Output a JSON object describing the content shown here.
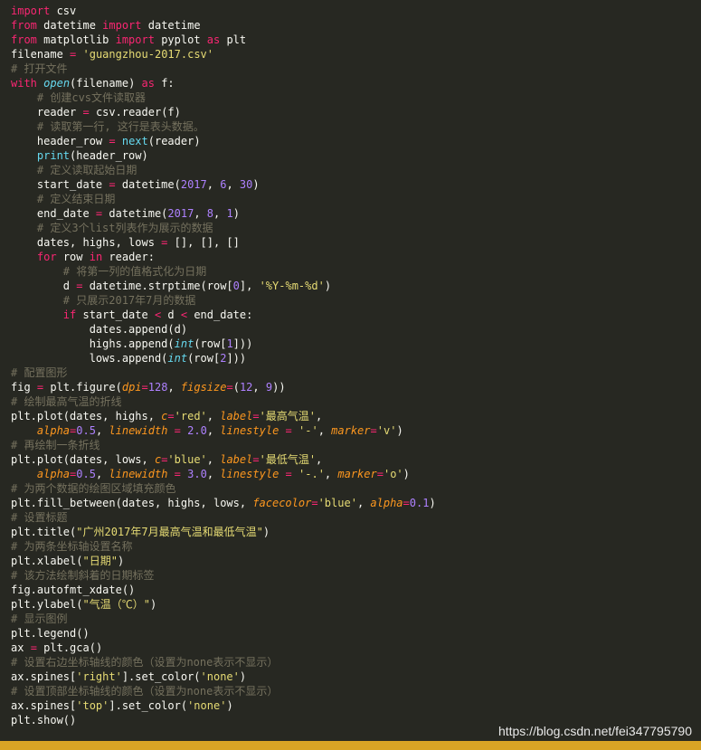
{
  "code_lines": [
    [
      {
        "t": "import",
        "c": "kw"
      },
      {
        "t": " csv"
      }
    ],
    [
      {
        "t": "from",
        "c": "kw"
      },
      {
        "t": " datetime "
      },
      {
        "t": "import",
        "c": "kw"
      },
      {
        "t": " datetime"
      }
    ],
    [
      {
        "t": "from",
        "c": "kw"
      },
      {
        "t": " matplotlib "
      },
      {
        "t": "import",
        "c": "kw"
      },
      {
        "t": " pyplot "
      },
      {
        "t": "as",
        "c": "kw"
      },
      {
        "t": " plt"
      }
    ],
    [
      {
        "t": "filename "
      },
      {
        "t": "=",
        "c": "op"
      },
      {
        "t": " "
      },
      {
        "t": "'guangzhou-2017.csv'",
        "c": "str"
      }
    ],
    [
      {
        "t": "# 打开文件",
        "c": "cm"
      }
    ],
    [
      {
        "t": "with",
        "c": "kw"
      },
      {
        "t": " "
      },
      {
        "t": "open",
        "c": "it"
      },
      {
        "t": "(filename) "
      },
      {
        "t": "as",
        "c": "kw"
      },
      {
        "t": " f:"
      }
    ],
    [
      {
        "t": "    # 创建cvs文件读取器",
        "c": "cm"
      }
    ],
    [
      {
        "t": "    reader "
      },
      {
        "t": "=",
        "c": "op"
      },
      {
        "t": " csv.reader(f)"
      }
    ],
    [
      {
        "t": "    # 读取第一行, 这行是表头数据。",
        "c": "cm"
      }
    ],
    [
      {
        "t": "    header_row "
      },
      {
        "t": "=",
        "c": "op"
      },
      {
        "t": " "
      },
      {
        "t": "next",
        "c": "bi"
      },
      {
        "t": "(reader)"
      }
    ],
    [
      {
        "t": "    "
      },
      {
        "t": "print",
        "c": "bi"
      },
      {
        "t": "(header_row)"
      }
    ],
    [
      {
        "t": "    # 定义读取起始日期",
        "c": "cm"
      }
    ],
    [
      {
        "t": "    start_date "
      },
      {
        "t": "=",
        "c": "op"
      },
      {
        "t": " datetime("
      },
      {
        "t": "2017",
        "c": "num"
      },
      {
        "t": ", "
      },
      {
        "t": "6",
        "c": "num"
      },
      {
        "t": ", "
      },
      {
        "t": "30",
        "c": "num"
      },
      {
        "t": ")"
      }
    ],
    [
      {
        "t": "    # 定义结束日期",
        "c": "cm"
      }
    ],
    [
      {
        "t": "    end_date "
      },
      {
        "t": "=",
        "c": "op"
      },
      {
        "t": " datetime("
      },
      {
        "t": "2017",
        "c": "num"
      },
      {
        "t": ", "
      },
      {
        "t": "8",
        "c": "num"
      },
      {
        "t": ", "
      },
      {
        "t": "1",
        "c": "num"
      },
      {
        "t": ")"
      }
    ],
    [
      {
        "t": "    # 定义3个list列表作为展示的数据",
        "c": "cm"
      }
    ],
    [
      {
        "t": "    dates, highs, lows "
      },
      {
        "t": "=",
        "c": "op"
      },
      {
        "t": " [], [], []"
      }
    ],
    [
      {
        "t": "    "
      },
      {
        "t": "for",
        "c": "kw"
      },
      {
        "t": " row "
      },
      {
        "t": "in",
        "c": "kw"
      },
      {
        "t": " reader:"
      }
    ],
    [
      {
        "t": "        # 将第一列的值格式化为日期",
        "c": "cm"
      }
    ],
    [
      {
        "t": "        d "
      },
      {
        "t": "=",
        "c": "op"
      },
      {
        "t": " datetime.strptime(row["
      },
      {
        "t": "0",
        "c": "num"
      },
      {
        "t": "], "
      },
      {
        "t": "'%Y-%m-%d'",
        "c": "str"
      },
      {
        "t": ")"
      }
    ],
    [
      {
        "t": "        # 只展示2017年7月的数据",
        "c": "cm"
      }
    ],
    [
      {
        "t": "        "
      },
      {
        "t": "if",
        "c": "kw"
      },
      {
        "t": " start_date "
      },
      {
        "t": "<",
        "c": "op"
      },
      {
        "t": " d "
      },
      {
        "t": "<",
        "c": "op"
      },
      {
        "t": " end_date:"
      }
    ],
    [
      {
        "t": "            dates.append(d)"
      }
    ],
    [
      {
        "t": "            highs.append("
      },
      {
        "t": "int",
        "c": "it"
      },
      {
        "t": "(row["
      },
      {
        "t": "1",
        "c": "num"
      },
      {
        "t": "]))"
      }
    ],
    [
      {
        "t": "            lows.append("
      },
      {
        "t": "int",
        "c": "it"
      },
      {
        "t": "(row["
      },
      {
        "t": "2",
        "c": "num"
      },
      {
        "t": "]))"
      }
    ],
    [
      {
        "t": "# 配置图形",
        "c": "cm"
      }
    ],
    [
      {
        "t": "fig "
      },
      {
        "t": "=",
        "c": "op"
      },
      {
        "t": " plt.figure("
      },
      {
        "t": "dpi",
        "c": "kwarg"
      },
      {
        "t": "=",
        "c": "op"
      },
      {
        "t": "128",
        "c": "num"
      },
      {
        "t": ", "
      },
      {
        "t": "figsize",
        "c": "kwarg"
      },
      {
        "t": "=",
        "c": "op"
      },
      {
        "t": "("
      },
      {
        "t": "12",
        "c": "num"
      },
      {
        "t": ", "
      },
      {
        "t": "9",
        "c": "num"
      },
      {
        "t": "))"
      }
    ],
    [
      {
        "t": "# 绘制最高气温的折线",
        "c": "cm"
      }
    ],
    [
      {
        "t": "plt.plot(dates, highs, "
      },
      {
        "t": "c",
        "c": "kwarg"
      },
      {
        "t": "=",
        "c": "op"
      },
      {
        "t": "'red'",
        "c": "str"
      },
      {
        "t": ", "
      },
      {
        "t": "label",
        "c": "kwarg"
      },
      {
        "t": "=",
        "c": "op"
      },
      {
        "t": "'最高气温'",
        "c": "str"
      },
      {
        "t": ","
      }
    ],
    [
      {
        "t": "    "
      },
      {
        "t": "alpha",
        "c": "kwarg"
      },
      {
        "t": "=",
        "c": "op"
      },
      {
        "t": "0.5",
        "c": "num"
      },
      {
        "t": ", "
      },
      {
        "t": "linewidth",
        "c": "kwarg"
      },
      {
        "t": " "
      },
      {
        "t": "=",
        "c": "op"
      },
      {
        "t": " "
      },
      {
        "t": "2.0",
        "c": "num"
      },
      {
        "t": ", "
      },
      {
        "t": "linestyle",
        "c": "kwarg"
      },
      {
        "t": " "
      },
      {
        "t": "=",
        "c": "op"
      },
      {
        "t": " "
      },
      {
        "t": "'-'",
        "c": "str"
      },
      {
        "t": ", "
      },
      {
        "t": "marker",
        "c": "kwarg"
      },
      {
        "t": "=",
        "c": "op"
      },
      {
        "t": "'v'",
        "c": "str"
      },
      {
        "t": ")"
      }
    ],
    [
      {
        "t": "# 再绘制一条折线",
        "c": "cm"
      }
    ],
    [
      {
        "t": "plt.plot(dates, lows, "
      },
      {
        "t": "c",
        "c": "kwarg"
      },
      {
        "t": "=",
        "c": "op"
      },
      {
        "t": "'blue'",
        "c": "str"
      },
      {
        "t": ", "
      },
      {
        "t": "label",
        "c": "kwarg"
      },
      {
        "t": "=",
        "c": "op"
      },
      {
        "t": "'最低气温'",
        "c": "str"
      },
      {
        "t": ","
      }
    ],
    [
      {
        "t": "    "
      },
      {
        "t": "alpha",
        "c": "kwarg"
      },
      {
        "t": "=",
        "c": "op"
      },
      {
        "t": "0.5",
        "c": "num"
      },
      {
        "t": ", "
      },
      {
        "t": "linewidth",
        "c": "kwarg"
      },
      {
        "t": " "
      },
      {
        "t": "=",
        "c": "op"
      },
      {
        "t": " "
      },
      {
        "t": "3.0",
        "c": "num"
      },
      {
        "t": ", "
      },
      {
        "t": "linestyle",
        "c": "kwarg"
      },
      {
        "t": " "
      },
      {
        "t": "=",
        "c": "op"
      },
      {
        "t": " "
      },
      {
        "t": "'-.'",
        "c": "str"
      },
      {
        "t": ", "
      },
      {
        "t": "marker",
        "c": "kwarg"
      },
      {
        "t": "=",
        "c": "op"
      },
      {
        "t": "'o'",
        "c": "str"
      },
      {
        "t": ")"
      }
    ],
    [
      {
        "t": "# 为两个数据的绘图区域填充颜色",
        "c": "cm"
      }
    ],
    [
      {
        "t": "plt.fill_between(dates, highs, lows, "
      },
      {
        "t": "facecolor",
        "c": "kwarg"
      },
      {
        "t": "=",
        "c": "op"
      },
      {
        "t": "'blue'",
        "c": "str"
      },
      {
        "t": ", "
      },
      {
        "t": "alpha",
        "c": "kwarg"
      },
      {
        "t": "=",
        "c": "op"
      },
      {
        "t": "0.1",
        "c": "num"
      },
      {
        "t": ")"
      }
    ],
    [
      {
        "t": "# 设置标题",
        "c": "cm"
      }
    ],
    [
      {
        "t": "plt.title("
      },
      {
        "t": "\"广州2017年7月最高气温和最低气温\"",
        "c": "str"
      },
      {
        "t": ")"
      }
    ],
    [
      {
        "t": "# 为两条坐标轴设置名称",
        "c": "cm"
      }
    ],
    [
      {
        "t": "plt.xlabel("
      },
      {
        "t": "\"日期\"",
        "c": "str"
      },
      {
        "t": ")"
      }
    ],
    [
      {
        "t": "# 该方法绘制斜着的日期标签",
        "c": "cm"
      }
    ],
    [
      {
        "t": "fig.autofmt_xdate()"
      }
    ],
    [
      {
        "t": "plt.ylabel("
      },
      {
        "t": "\"气温（℃）\"",
        "c": "str"
      },
      {
        "t": ")"
      }
    ],
    [
      {
        "t": "# 显示图例",
        "c": "cm"
      }
    ],
    [
      {
        "t": "plt.legend()"
      }
    ],
    [
      {
        "t": "ax "
      },
      {
        "t": "=",
        "c": "op"
      },
      {
        "t": " plt.gca()"
      }
    ],
    [
      {
        "t": "# 设置右边坐标轴线的颜色（设置为none表示不显示）",
        "c": "cm"
      }
    ],
    [
      {
        "t": "ax.spines["
      },
      {
        "t": "'right'",
        "c": "str"
      },
      {
        "t": "].set_color("
      },
      {
        "t": "'none'",
        "c": "str"
      },
      {
        "t": ")"
      }
    ],
    [
      {
        "t": "# 设置顶部坐标轴线的颜色（设置为none表示不显示）",
        "c": "cm"
      }
    ],
    [
      {
        "t": "ax.spines["
      },
      {
        "t": "'top'",
        "c": "str"
      },
      {
        "t": "].set_color("
      },
      {
        "t": "'none'",
        "c": "str"
      },
      {
        "t": ")"
      }
    ],
    [
      {
        "t": "plt.show()"
      }
    ]
  ],
  "watermark": "https://blog.csdn.net/fei347795790",
  "colors": {
    "background": "#272822",
    "keyword": "#f92672",
    "string": "#e6db74",
    "number": "#ae81ff",
    "comment": "#75715e",
    "builtin": "#66d9ef",
    "kwarg": "#fd971f",
    "bottom_bar": "#d9a425"
  }
}
